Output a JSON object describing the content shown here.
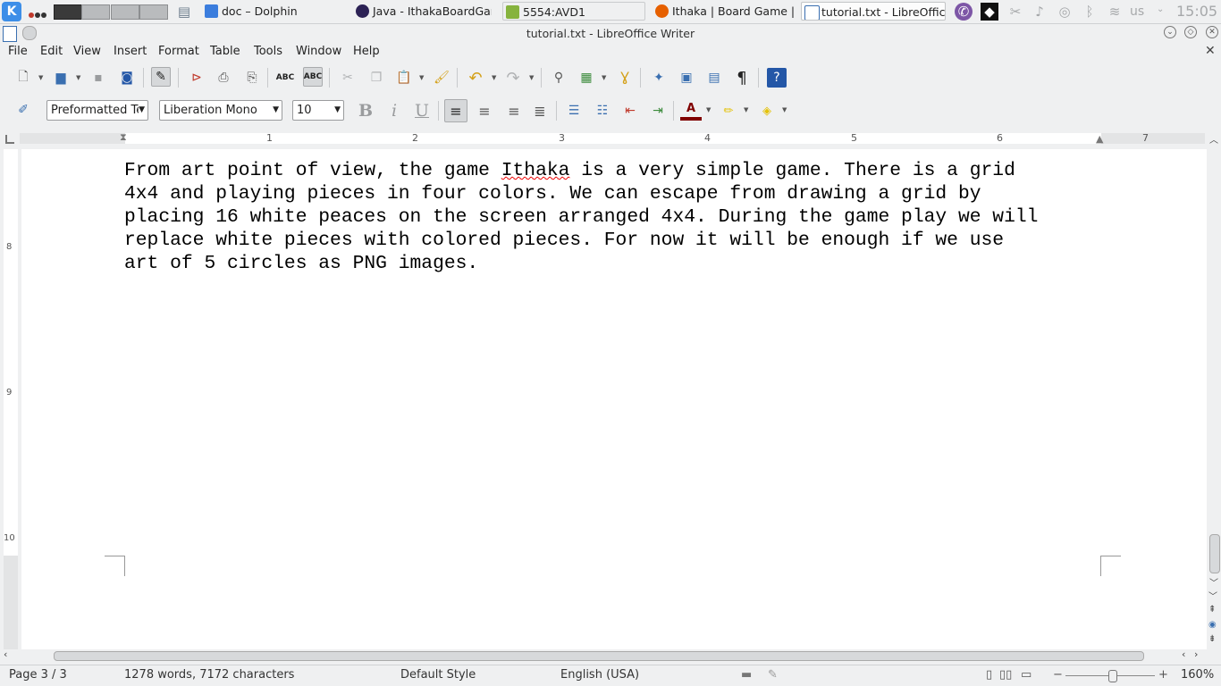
{
  "taskbar": {
    "tasks": [
      {
        "label": "doc – Dolphin"
      },
      {
        "label": "Java - IthakaBoardGam"
      },
      {
        "label": "5554:AVD1"
      },
      {
        "label": "Ithaka | Board Game | B"
      },
      {
        "label": "tutorial.txt - LibreOffic"
      }
    ],
    "keyboard_layout": "us",
    "clock": "15:05"
  },
  "window": {
    "title": "tutorial.txt - LibreOffice Writer"
  },
  "menubar": {
    "items": [
      "File",
      "Edit",
      "View",
      "Insert",
      "Format",
      "Table",
      "Tools",
      "Window",
      "Help"
    ]
  },
  "formatting": {
    "paragraph_style": "Preformatted Text",
    "font_name": "Liberation Mono",
    "font_size": "10"
  },
  "ruler": {
    "h_numbers": [
      "1",
      "2",
      "3",
      "4",
      "5",
      "6",
      "7"
    ],
    "v_numbers": [
      "8",
      "9",
      "10"
    ]
  },
  "document": {
    "lines": [
      "From art point of view, the game ",
      "Ithaka",
      " is a very simple game. There is a grid\n4x4 and playing pieces in four colors. We can escape from drawing a grid by\nplacing 16 white peaces on the screen arranged 4x4. During the game play we will\nreplace white pieces with colored pieces. For now it will be enough if we use\nart of 5 circles as PNG images."
    ]
  },
  "statusbar": {
    "page": "Page 3 / 3",
    "word_count": "1278 words, 7172 characters",
    "page_style": "Default Style",
    "language": "English (USA)",
    "zoom": "160%"
  }
}
